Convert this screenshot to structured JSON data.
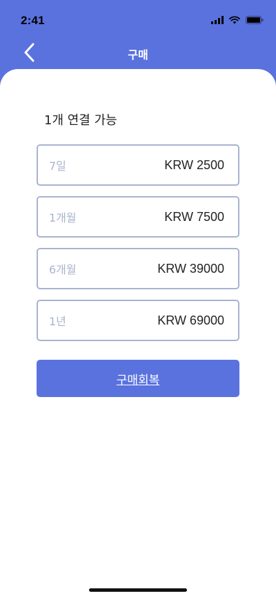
{
  "status_bar": {
    "time": "2:41"
  },
  "nav": {
    "title": "구매",
    "back_icon": "chevron-left-icon"
  },
  "content": {
    "caption": "1개 연결 가능",
    "plans": [
      {
        "duration": "7일",
        "price": "KRW 2500"
      },
      {
        "duration": "1개월",
        "price": "KRW 7500"
      },
      {
        "duration": "6개월",
        "price": "KRW 39000"
      },
      {
        "duration": "1년",
        "price": "KRW 69000"
      }
    ],
    "restore_label": "구매회복"
  },
  "colors": {
    "accent": "#5a72de",
    "border": "#a7b3cf",
    "placeholder": "#a9b3cc"
  }
}
